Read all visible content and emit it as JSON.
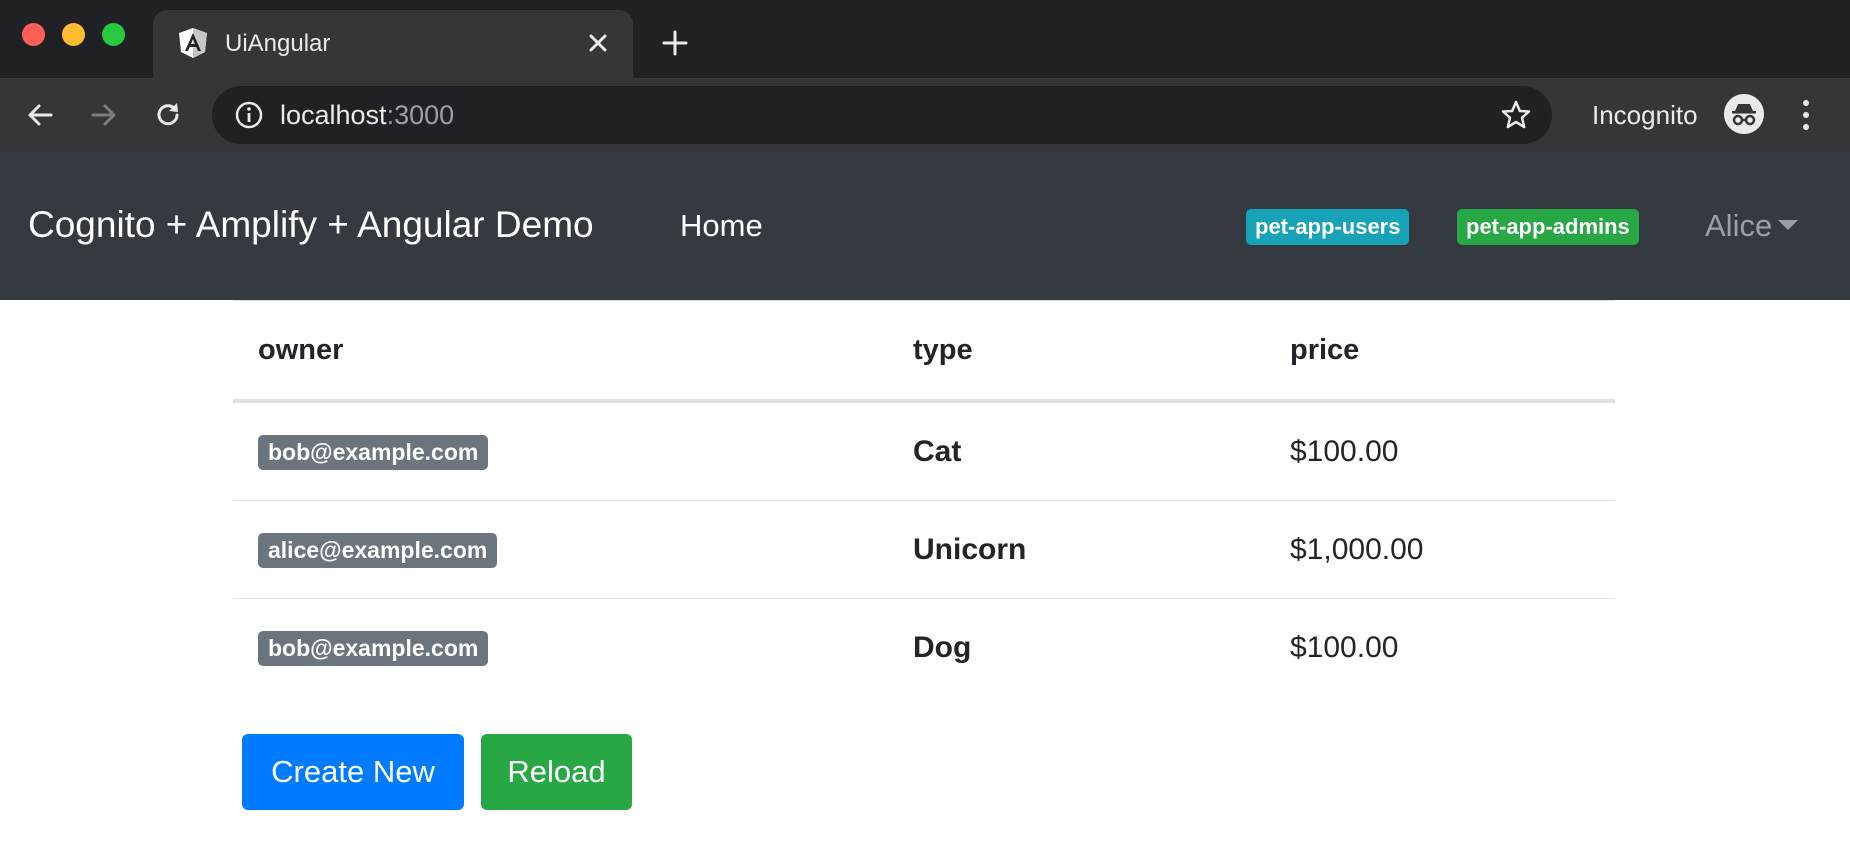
{
  "browser": {
    "tab_title": "UiAngular",
    "url_host": "localhost",
    "url_port": ":3000",
    "incognito_label": "Incognito"
  },
  "navbar": {
    "brand": "Cognito + Amplify + Angular Demo",
    "home_link": "Home",
    "groups": [
      "pet-app-users",
      "pet-app-admins"
    ],
    "user_name": "Alice"
  },
  "table": {
    "headers": {
      "owner": "owner",
      "type": "type",
      "price": "price"
    },
    "rows": [
      {
        "owner": "bob@example.com",
        "type": "Cat",
        "price": "$100.00"
      },
      {
        "owner": "alice@example.com",
        "type": "Unicorn",
        "price": "$1,000.00"
      },
      {
        "owner": "bob@example.com",
        "type": "Dog",
        "price": "$100.00"
      }
    ]
  },
  "actions": {
    "create_label": "Create New",
    "reload_label": "Reload"
  },
  "colors": {
    "navbar_bg": "#343a40",
    "primary": "#007bff",
    "success": "#28a745",
    "info": "#17a2b8",
    "secondary": "#6c757d"
  }
}
